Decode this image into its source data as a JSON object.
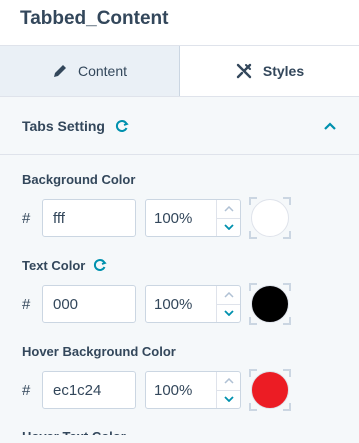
{
  "title": "Tabbed_Content",
  "tabs": {
    "content_label": "Content",
    "styles_label": "Styles"
  },
  "section": {
    "label": "Tabs Setting"
  },
  "colors": {
    "accent": "#0091ae"
  },
  "fields": {
    "background": {
      "label": "Background Color",
      "hex": "fff",
      "opacity": "100%",
      "swatch": "#ffffff"
    },
    "text": {
      "label": "Text Color",
      "hex": "000",
      "opacity": "100%",
      "swatch": "#000000"
    },
    "hover_background": {
      "label": "Hover Background Color",
      "hex": "ec1c24",
      "opacity": "100%",
      "swatch": "#ec1c24"
    },
    "next_partial": {
      "label": "Hover Text Color"
    }
  },
  "hash_symbol": "#"
}
